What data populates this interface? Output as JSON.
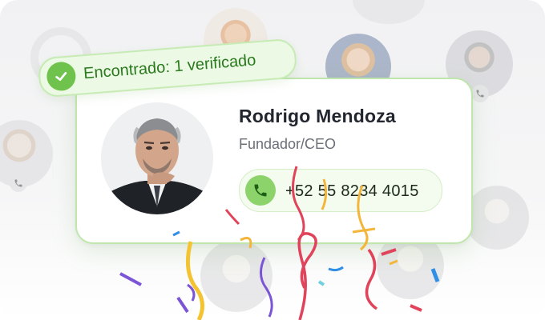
{
  "badge": {
    "label": "Encontrado: 1 verificado",
    "icon": "check-icon"
  },
  "contact": {
    "name": "Rodrigo Mendoza",
    "role": "Fundador/CEO",
    "phone": "+52 55 8234 4015",
    "phone_icon": "phone-icon"
  },
  "colors": {
    "accent_green": "#8bd36a",
    "badge_text": "#2a7a1e",
    "card_border": "#bfe7ad"
  }
}
